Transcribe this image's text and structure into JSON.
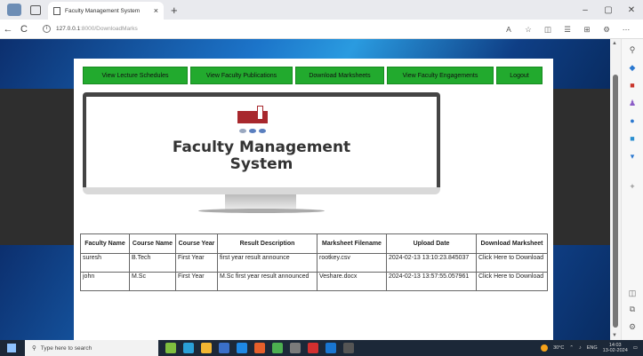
{
  "browser": {
    "tab_title": "Faculty Management System",
    "tab_close": "×",
    "new_tab": "+",
    "url_host": "127.0.0.1",
    "url_path": ":8000/DownloadMarks",
    "back": "←",
    "refresh": "C",
    "window_controls": [
      "–",
      "▢",
      "✕"
    ]
  },
  "nav": {
    "items": [
      "View Lecture Schedules",
      "View Faculty Publications",
      "Download Marksheets",
      "View Faculty Engagements",
      "Logout"
    ]
  },
  "banner": {
    "title_line1": "Faculty Management",
    "title_line2": "System"
  },
  "table": {
    "headers": [
      "Faculty Name",
      "Course Name",
      "Course Year",
      "Result Description",
      "Marksheet Filename",
      "Upload Date",
      "Download Marksheet"
    ],
    "rows": [
      [
        "suresh",
        "B.Tech",
        "First Year",
        "first year result announce",
        "rootkey.csv",
        "2024-02-13 13:10:23.845037",
        "Click Here to Download"
      ],
      [
        "john",
        "M.Sc",
        "First Year",
        "M.Sc first year result announced",
        "Veshare.docx",
        "2024-02-13 13:57:55.057961",
        "Click Here to Download"
      ]
    ]
  },
  "taskbar": {
    "search_placeholder": "Type here to search",
    "weather": "30°C",
    "language": "ENG",
    "time": "14:03",
    "date": "13-02-2024"
  },
  "colors": {
    "nav_button": "#22aa2e",
    "logo_red": "#a8282d",
    "taskbar": "#1c2838"
  }
}
